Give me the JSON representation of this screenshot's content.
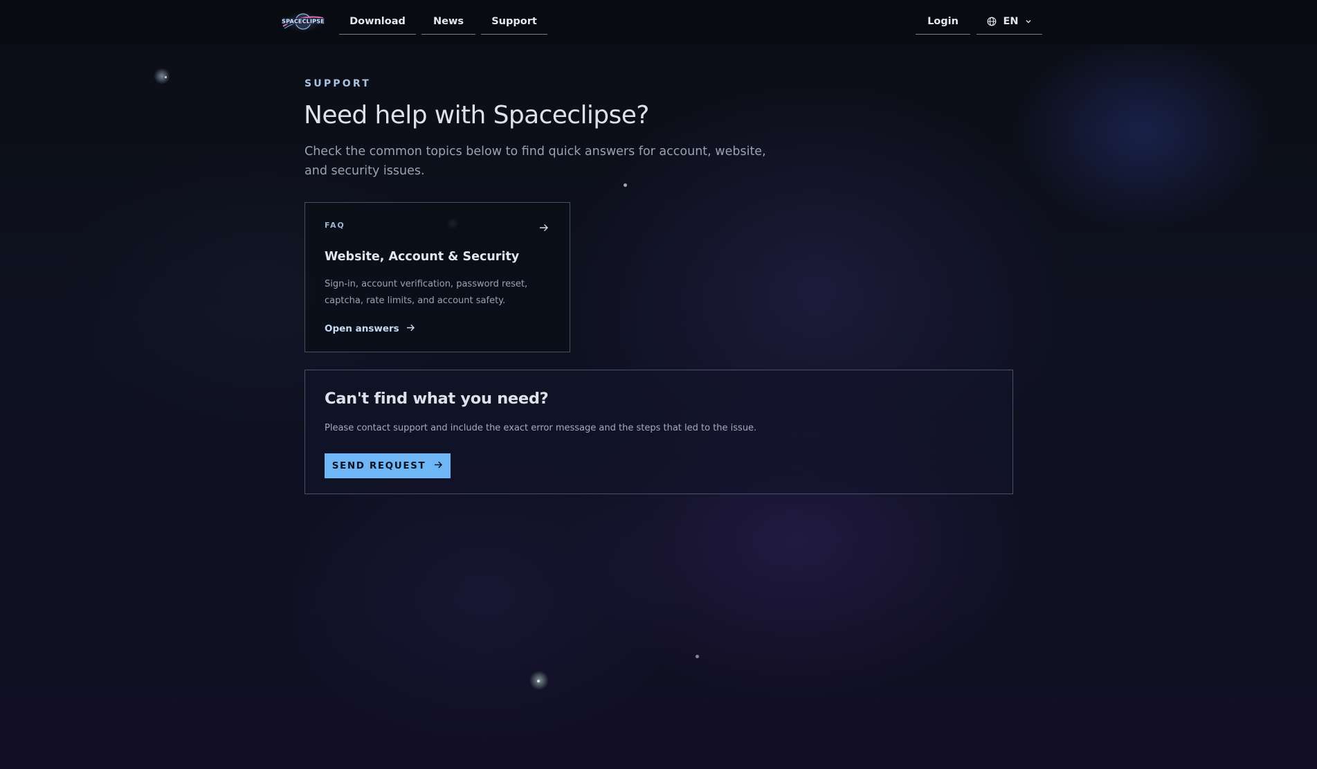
{
  "header": {
    "logo_alt": "SPACECLIPSE",
    "nav": [
      {
        "label": "Download"
      },
      {
        "label": "News"
      },
      {
        "label": "Support"
      }
    ],
    "login_label": "Login",
    "language": {
      "selected": "EN"
    }
  },
  "hero": {
    "eyebrow": "SUPPORT",
    "title": "Need help with Spaceclipse?",
    "subtitle": "Check the common topics below to find quick answers for account, website, and security issues."
  },
  "faq_card": {
    "tag": "FAQ",
    "title": "Website, Account & Security",
    "description": "Sign-in, account verification, password reset, captcha, rate limits, and account safety.",
    "link_label": "Open answers"
  },
  "contact": {
    "title": "Can't find what you need?",
    "description": "Please contact support and include the exact error message and the steps that led to the issue.",
    "button_label": "SEND REQUEST"
  },
  "colors": {
    "accent": "#6fb6f7",
    "background": "#0e1120",
    "text": "#dde1e9"
  }
}
